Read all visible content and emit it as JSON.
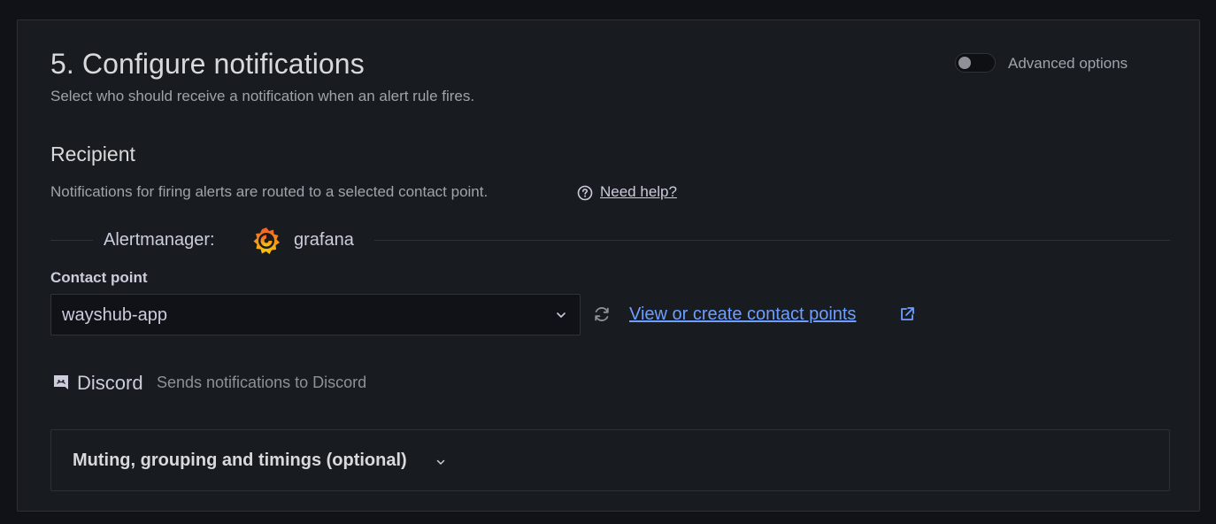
{
  "section": {
    "title": "5. Configure notifications",
    "subtitle": "Select who should receive a notification when an alert rule fires.",
    "advanced_options_label": "Advanced options",
    "advanced_options_enabled": false
  },
  "recipient": {
    "heading": "Recipient",
    "description": "Notifications for firing alerts are routed to a selected contact point.",
    "help_link": "Need help?"
  },
  "alertmanager": {
    "label": "Alertmanager:",
    "value": "grafana",
    "icon": "grafana-logo"
  },
  "contact_point": {
    "label": "Contact point",
    "value": "wayshub-app",
    "view_link": "View or create contact points"
  },
  "integration": {
    "icon": "discord-icon",
    "name": "Discord",
    "description": "Sends notifications to Discord"
  },
  "collapsible": {
    "label": "Muting, grouping and timings (optional)",
    "expanded": false
  },
  "colors": {
    "background": "#111217",
    "panel": "#181b1f",
    "border": "#2c3036",
    "text": "#ccccdc",
    "muted_text": "#a0a3ab",
    "link": "#6e9fff"
  }
}
